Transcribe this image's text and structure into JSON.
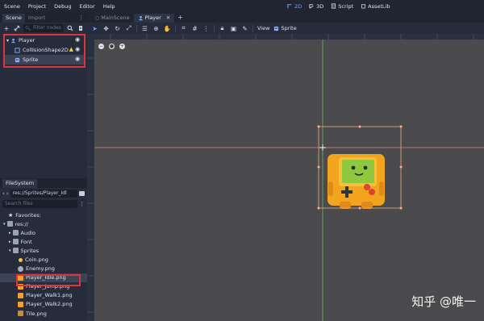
{
  "menubar": {
    "items": [
      "Scene",
      "Project",
      "Debug",
      "Editor",
      "Help"
    ],
    "workspaces": [
      {
        "label": "2D",
        "icon": "2d-icon",
        "active": true
      },
      {
        "label": "3D",
        "icon": "3d-icon",
        "active": false
      },
      {
        "label": "Script",
        "icon": "script-icon",
        "active": false
      },
      {
        "label": "AssetLib",
        "icon": "assetlib-icon",
        "active": false
      }
    ]
  },
  "scene_dock": {
    "tabs": [
      "Scene",
      "Import"
    ],
    "filter_placeholder": "Filter nodes",
    "nodes": [
      {
        "label": "Player",
        "icon": "node2d-icon"
      },
      {
        "label": "CollisionShape2D",
        "icon": "collisionshape-icon",
        "warning": true
      },
      {
        "label": "Sprite",
        "icon": "sprite-icon",
        "selected": true
      }
    ]
  },
  "filesystem": {
    "tab": "FileSystem",
    "path": "res://Sprites/Player_Idl",
    "search_placeholder": "Search files",
    "items": [
      {
        "label": "Favorites:",
        "indent": 0,
        "icon": "star-icon"
      },
      {
        "label": "res://",
        "indent": 0,
        "icon": "folder-icon"
      },
      {
        "label": "Audio",
        "indent": 1,
        "icon": "folder-icon"
      },
      {
        "label": "Font",
        "indent": 1,
        "icon": "folder-icon"
      },
      {
        "label": "Sprites",
        "indent": 1,
        "icon": "folder-icon"
      },
      {
        "label": "Coin.png",
        "indent": 2,
        "icon": "image-icon"
      },
      {
        "label": "Enemy.png",
        "indent": 2,
        "icon": "image-icon"
      },
      {
        "label": "Player_Idle.png",
        "indent": 2,
        "icon": "image-icon",
        "selected": true
      },
      {
        "label": "Player_Jump.png",
        "indent": 2,
        "icon": "image-icon"
      },
      {
        "label": "Player_Walk1.png",
        "indent": 2,
        "icon": "image-icon"
      },
      {
        "label": "Player_Walk2.png",
        "indent": 2,
        "icon": "image-icon"
      },
      {
        "label": "Tile.png",
        "indent": 2,
        "icon": "image-icon"
      }
    ]
  },
  "scene_tabs": [
    {
      "label": "MainScene",
      "active": false
    },
    {
      "label": "Player",
      "active": true
    }
  ],
  "viewport_toolbar": {
    "view_label": "View",
    "sprite_label": "Sprite"
  },
  "colors": {
    "accent": "#6ea8ff",
    "highlight_box": "#e0343a",
    "viewport_bg": "#4b4b4d"
  },
  "watermark": "知乎 @唯一"
}
